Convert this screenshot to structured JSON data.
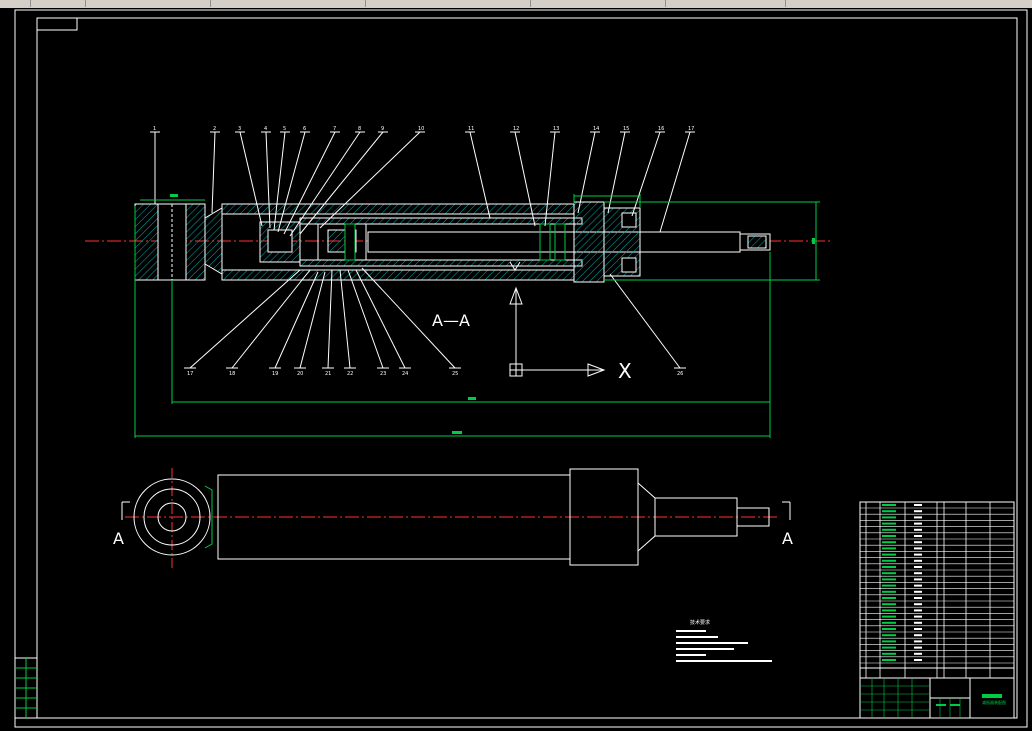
{
  "window": {
    "title": ""
  },
  "drawing": {
    "section_label": "A—A",
    "axis_x_label": "X",
    "view_label_left": "A",
    "view_label_right": "A",
    "colors": {
      "background": "#000000",
      "outline": "#ffffff",
      "dimension": "#00cc44",
      "centerline": "#ff3030",
      "hatch": "#00aaaa"
    },
    "balloons_top": [
      "1",
      "2",
      "3",
      "4",
      "5",
      "6",
      "7",
      "8",
      "9",
      "10",
      "11",
      "12",
      "13",
      "14",
      "15",
      "16",
      "17"
    ],
    "balloons_bottom": [
      "17",
      "18",
      "19",
      "20",
      "21",
      "22",
      "23",
      "24",
      "25",
      "26"
    ],
    "tech_requirements_title": "技术要求",
    "title_block_name": "减振器装配图"
  }
}
